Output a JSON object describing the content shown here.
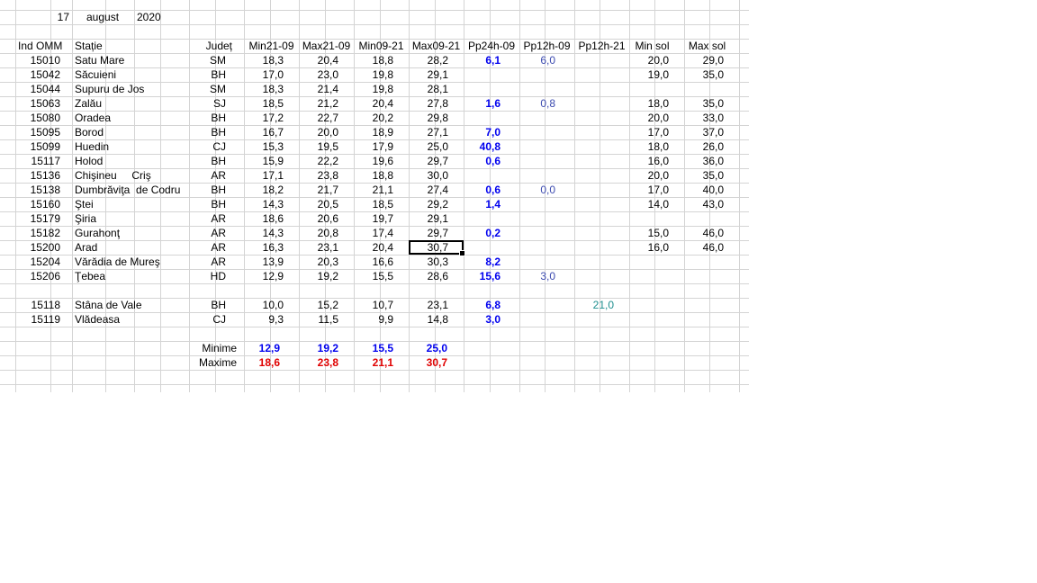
{
  "date": {
    "day": "17",
    "month": "august",
    "year": "2020"
  },
  "headers": [
    "Ind OMM",
    "Stație",
    "Județ",
    "Min21-09",
    "Max21-09",
    "Min09-21",
    "Max09-21",
    "Pp24h-09",
    "Pp12h-09",
    "Pp12h-21",
    "Min sol",
    "Max sol"
  ],
  "rows": [
    {
      "id": "15010",
      "station": "Satu Mare",
      "county": "SM",
      "min2109": "18,3",
      "max2109": "20,4",
      "min0921": "18,8",
      "max0921": "28,2",
      "pp24": "6,1",
      "pp12_09": "6,0",
      "pp12_21": "",
      "minsol": "20,0",
      "maxsol": "29,0"
    },
    {
      "id": "15042",
      "station": "Săcuieni",
      "county": "BH",
      "min2109": "17,0",
      "max2109": "23,0",
      "min0921": "19,8",
      "max0921": "29,1",
      "pp24": "",
      "pp12_09": "",
      "pp12_21": "",
      "minsol": "19,0",
      "maxsol": "35,0"
    },
    {
      "id": "15044",
      "station": "Supuru de Jos",
      "county": "SM",
      "min2109": "18,3",
      "max2109": "21,4",
      "min0921": "19,8",
      "max0921": "28,1",
      "pp24": "",
      "pp12_09": "",
      "pp12_21": "",
      "minsol": "",
      "maxsol": ""
    },
    {
      "id": "15063",
      "station": "Zalău",
      "county": "SJ",
      "min2109": "18,5",
      "max2109": "21,2",
      "min0921": "20,4",
      "max0921": "27,8",
      "pp24": "1,6",
      "pp12_09": "0,8",
      "pp12_21": "",
      "minsol": "18,0",
      "maxsol": "35,0"
    },
    {
      "id": "15080",
      "station": "Oradea",
      "county": "BH",
      "min2109": "17,2",
      "max2109": "22,7",
      "min0921": "20,2",
      "max0921": "29,8",
      "pp24": "",
      "pp12_09": "",
      "pp12_21": "",
      "minsol": "20,0",
      "maxsol": "33,0"
    },
    {
      "id": "15095",
      "station": "Borod",
      "county": "BH",
      "min2109": "16,7",
      "max2109": "20,0",
      "min0921": "18,9",
      "max0921": "27,1",
      "pp24": "7,0",
      "pp12_09": "",
      "pp12_21": "",
      "minsol": "17,0",
      "maxsol": "37,0"
    },
    {
      "id": "15099",
      "station": "Huedin",
      "county": "CJ",
      "min2109": "15,3",
      "max2109": "19,5",
      "min0921": "17,9",
      "max0921": "25,0",
      "pp24": "40,8",
      "pp12_09": "",
      "pp12_21": "",
      "minsol": "18,0",
      "maxsol": "26,0"
    },
    {
      "id": "15117",
      "station": "Holod",
      "county": "BH",
      "min2109": "15,9",
      "max2109": "22,2",
      "min0921": "19,6",
      "max0921": "29,7",
      "pp24": "0,6",
      "pp12_09": "",
      "pp12_21": "",
      "minsol": "16,0",
      "maxsol": "36,0"
    },
    {
      "id": "15136",
      "station": "Chişineu     Criş",
      "county": "AR",
      "min2109": "17,1",
      "max2109": "23,8",
      "min0921": "18,8",
      "max0921": "30,0",
      "pp24": "",
      "pp12_09": "",
      "pp12_21": "",
      "minsol": "20,0",
      "maxsol": "35,0"
    },
    {
      "id": "15138",
      "station": "Dumbrăviţa  de Codru",
      "county": "BH",
      "min2109": "18,2",
      "max2109": "21,7",
      "min0921": "21,1",
      "max0921": "27,4",
      "pp24": "0,6",
      "pp12_09": "0,0",
      "pp12_21": "",
      "minsol": "17,0",
      "maxsol": "40,0"
    },
    {
      "id": "15160",
      "station": "Ştei",
      "county": "BH",
      "min2109": "14,3",
      "max2109": "20,5",
      "min0921": "18,5",
      "max0921": "29,2",
      "pp24": "1,4",
      "pp12_09": "",
      "pp12_21": "",
      "minsol": "14,0",
      "maxsol": "43,0"
    },
    {
      "id": "15179",
      "station": "Şiria",
      "county": "AR",
      "min2109": "18,6",
      "max2109": "20,6",
      "min0921": "19,7",
      "max0921": "29,1",
      "pp24": "",
      "pp12_09": "",
      "pp12_21": "",
      "minsol": "",
      "maxsol": ""
    },
    {
      "id": "15182",
      "station": "Gurahonţ",
      "county": "AR",
      "min2109": "14,3",
      "max2109": "20,8",
      "min0921": "17,4",
      "max0921": "29,7",
      "pp24": "0,2",
      "pp12_09": "",
      "pp12_21": "",
      "minsol": "15,0",
      "maxsol": "46,0"
    },
    {
      "id": "15200",
      "station": "Arad",
      "county": "AR",
      "min2109": "16,3",
      "max2109": "23,1",
      "min0921": "20,4",
      "max0921": "30,7",
      "pp24": "",
      "pp12_09": "",
      "pp12_21": "",
      "minsol": "16,0",
      "maxsol": "46,0"
    },
    {
      "id": "15204",
      "station": "Vărădia de Mureş",
      "county": "AR",
      "min2109": "13,9",
      "max2109": "20,3",
      "min0921": "16,6",
      "max0921": "30,3",
      "pp24": "8,2",
      "pp12_09": "",
      "pp12_21": "",
      "minsol": "",
      "maxsol": ""
    },
    {
      "id": "15206",
      "station": "Ţebea",
      "county": "HD",
      "min2109": "12,9",
      "max2109": "19,2",
      "min0921": "15,5",
      "max0921": "28,6",
      "pp24": "15,6",
      "pp12_09": "3,0",
      "pp12_21": "",
      "minsol": "",
      "maxsol": ""
    }
  ],
  "mountain_rows": [
    {
      "id": "15118",
      "station": "Stâna de Vale",
      "county": "BH",
      "min2109": "10,0",
      "max2109": "15,2",
      "min0921": "10,7",
      "max0921": "23,1",
      "pp24": "6,8",
      "pp12_09": "",
      "pp12_21": "21,0",
      "minsol": "",
      "maxsol": ""
    },
    {
      "id": "15119",
      "station": "Vlădeasa",
      "county": "CJ",
      "min2109": "9,3",
      "max2109": "11,5",
      "min0921": "9,9",
      "max0921": "14,8",
      "pp24": "3,0",
      "pp12_09": "",
      "pp12_21": "",
      "minsol": "",
      "maxsol": ""
    }
  ],
  "summary": {
    "min_label": "Minime",
    "max_label": "Maxime",
    "minime": [
      "12,9",
      "19,2",
      "15,5",
      "25,0"
    ],
    "maxime": [
      "18,6",
      "23,8",
      "21,1",
      "30,7"
    ]
  },
  "colors": {
    "precip": "#0000ee",
    "minime": "#0000ee",
    "maxime": "#e00000",
    "pp12": "#3c4bb0",
    "pp12_21": "#1f8f8f",
    "grid": "#d4d4d4"
  }
}
